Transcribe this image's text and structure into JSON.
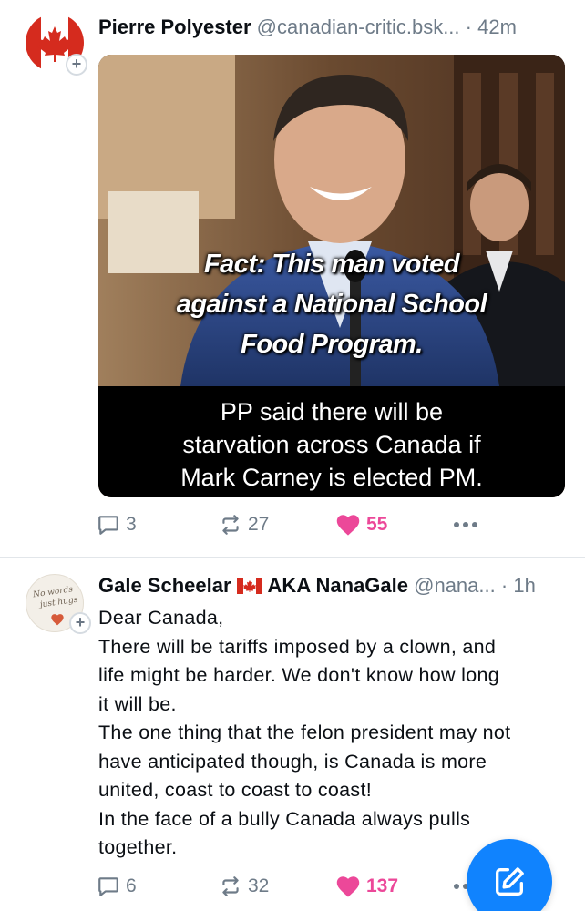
{
  "posts": [
    {
      "author": "Pierre Polyester",
      "handle": "@canadian-critic.bsk...",
      "separator": "·",
      "time": "42m",
      "image": {
        "caption_lines": [
          "Fact: This man voted",
          "against a National School",
          "Food Program."
        ],
        "subtitle_lines": [
          "PP said there will be",
          "starvation across Canada if",
          "Mark Carney is elected PM."
        ]
      },
      "replies": "3",
      "reposts": "27",
      "likes": "55",
      "liked": true
    },
    {
      "author_name": "Gale Scheelar",
      "author_suffix": "AKA NanaGale",
      "handle": "@nana...",
      "separator": "·",
      "time": "1h",
      "avatar_text": [
        "No words",
        "just hugs"
      ],
      "text_lines": [
        "Dear Canada,",
        "There will be tariffs imposed by a clown, and",
        "life might be harder. We don't know how long",
        "it will be.",
        "The one thing that the felon president may not",
        "have anticipated though, is Canada is more",
        "united, coast to coast to coast!",
        "In the face of a bully Canada always pulls",
        "together."
      ],
      "replies": "6",
      "reposts": "32",
      "likes": "137",
      "liked": true
    }
  ],
  "icons": {
    "avatar_follow": "+",
    "reply": "speech-bubble-icon",
    "repost": "repost-arrows-icon",
    "like": "heart-icon",
    "more": "ellipsis-icon",
    "compose": "compose-pencil-icon"
  },
  "colors": {
    "accent": "#1083fe",
    "like": "#ec4899",
    "muted": "#6e7b88",
    "flag_red": "#d52b1e"
  }
}
